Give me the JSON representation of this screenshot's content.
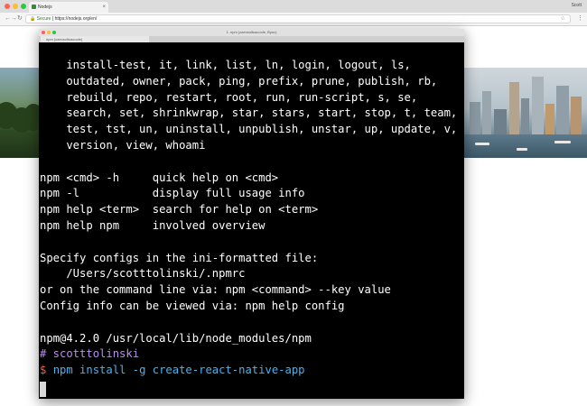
{
  "browser": {
    "tab_title": "Nodejs",
    "user_name": "Scott",
    "secure_label": "Secure",
    "url": "https://nodejs.org/en/",
    "address_separator": "|"
  },
  "terminal": {
    "title": "1. npm (caecsoltuacoole, Byoc)",
    "tab_label": "npm (caecsoltuacoole)",
    "lines": [
      {
        "text": "    install-test, it, link, list, ln, login, logout, ls,",
        "color": "#ffffff"
      },
      {
        "text": "    outdated, owner, pack, ping, prefix, prune, publish, rb,",
        "color": "#ffffff"
      },
      {
        "text": "    rebuild, repo, restart, root, run, run-script, s, se,",
        "color": "#ffffff"
      },
      {
        "text": "    search, set, shrinkwrap, star, stars, start, stop, t, team,",
        "color": "#ffffff"
      },
      {
        "text": "    test, tst, un, uninstall, unpublish, unstar, up, update, v,",
        "color": "#ffffff"
      },
      {
        "text": "    version, view, whoami",
        "color": "#ffffff"
      },
      {
        "text": "",
        "color": "#ffffff"
      },
      {
        "text": "npm <cmd> -h     quick help on <cmd>",
        "color": "#ffffff"
      },
      {
        "text": "npm -l           display full usage info",
        "color": "#ffffff"
      },
      {
        "text": "npm help <term>  search for help on <term>",
        "color": "#ffffff"
      },
      {
        "text": "npm help npm     involved overview",
        "color": "#ffffff"
      },
      {
        "text": "",
        "color": "#ffffff"
      },
      {
        "text": "Specify configs in the ini-formatted file:",
        "color": "#ffffff"
      },
      {
        "text": "    /Users/scotttolinski/.npmrc",
        "color": "#ffffff"
      },
      {
        "text": "or on the command line via: npm <command> --key value",
        "color": "#ffffff"
      },
      {
        "text": "Config info can be viewed via: npm help config",
        "color": "#ffffff"
      },
      {
        "text": "",
        "color": "#ffffff"
      },
      {
        "text": "npm@4.2.0 /usr/local/lib/node_modules/npm",
        "color": "#ffffff"
      },
      {
        "text": "# scotttolinski",
        "color": "#b88cf5"
      },
      {
        "text": "",
        "color": "#ffffff",
        "segments": [
          {
            "text": "$ ",
            "color": "#ff5a3c"
          },
          {
            "text": "npm install -g create-react-native-app",
            "color": "#46b4f0"
          }
        ]
      }
    ]
  }
}
